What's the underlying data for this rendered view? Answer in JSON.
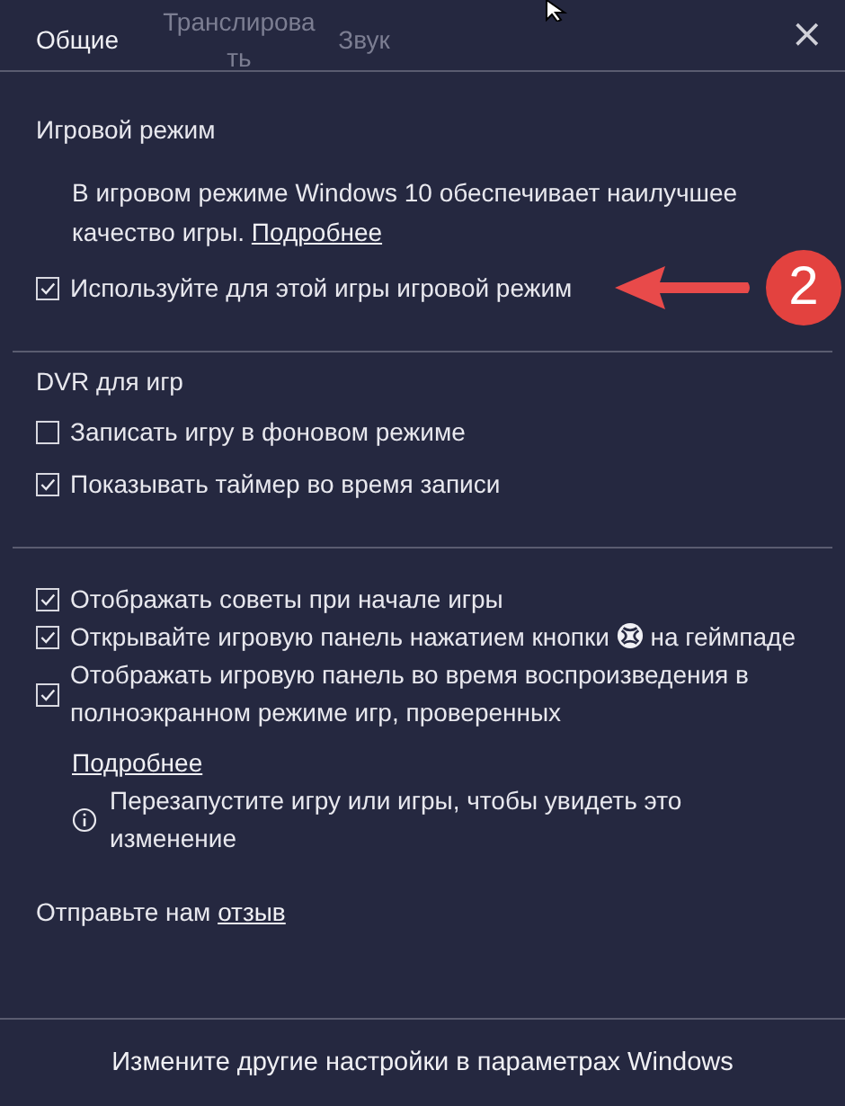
{
  "tabs": [
    {
      "label": "Общие",
      "selected": true
    },
    {
      "label": "Транслирова ть",
      "selected": false
    },
    {
      "label": "Звук",
      "selected": false
    }
  ],
  "close": "×",
  "game_mode": {
    "title": "Игровой режим",
    "description": "В игровом режиме Windows 10 обеспечивает наилучшее качество игры.",
    "link": "Подробнее",
    "option": {
      "label": "Используйте для этой игры игровой режим",
      "checked": true
    }
  },
  "annotation": {
    "badge": "2"
  },
  "dvr": {
    "title": "DVR для игр",
    "options": [
      {
        "label": "Записать игру в фоновом режиме",
        "checked": false
      },
      {
        "label": "Показывать таймер во время записи",
        "checked": true
      }
    ]
  },
  "options": [
    {
      "kind": "plain",
      "label": "Отображать советы при начале игры",
      "checked": true
    },
    {
      "kind": "button_icon",
      "label": "Открывайте игровую панель нажатием кнопки",
      "label_after": "на геймпаде",
      "checked": true
    },
    {
      "kind": "plain",
      "label": "Отображать игровую панель во время воспроизведения в полноэкранном режиме игр, проверенных",
      "checked": true
    }
  ],
  "more_link": "Подробнее",
  "info": "Перезапустите игру или игры, чтобы увидеть это изменение",
  "feedback": {
    "text": "Отправьте нам",
    "link": "отзыв"
  },
  "footer": "Измените другие настройки в параметрах Windows"
}
